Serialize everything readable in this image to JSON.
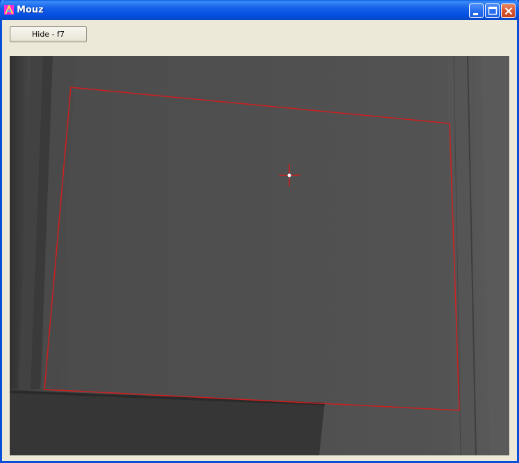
{
  "window": {
    "title": "Mouz",
    "controls": {
      "minimize": "minimize",
      "maximize": "maximize",
      "close": "close"
    }
  },
  "toolbar": {
    "hide_label": "Hide  - f7"
  },
  "camera_view": {
    "outline_color": "#d21e1e",
    "crosshair_color": "#d21e1e"
  }
}
